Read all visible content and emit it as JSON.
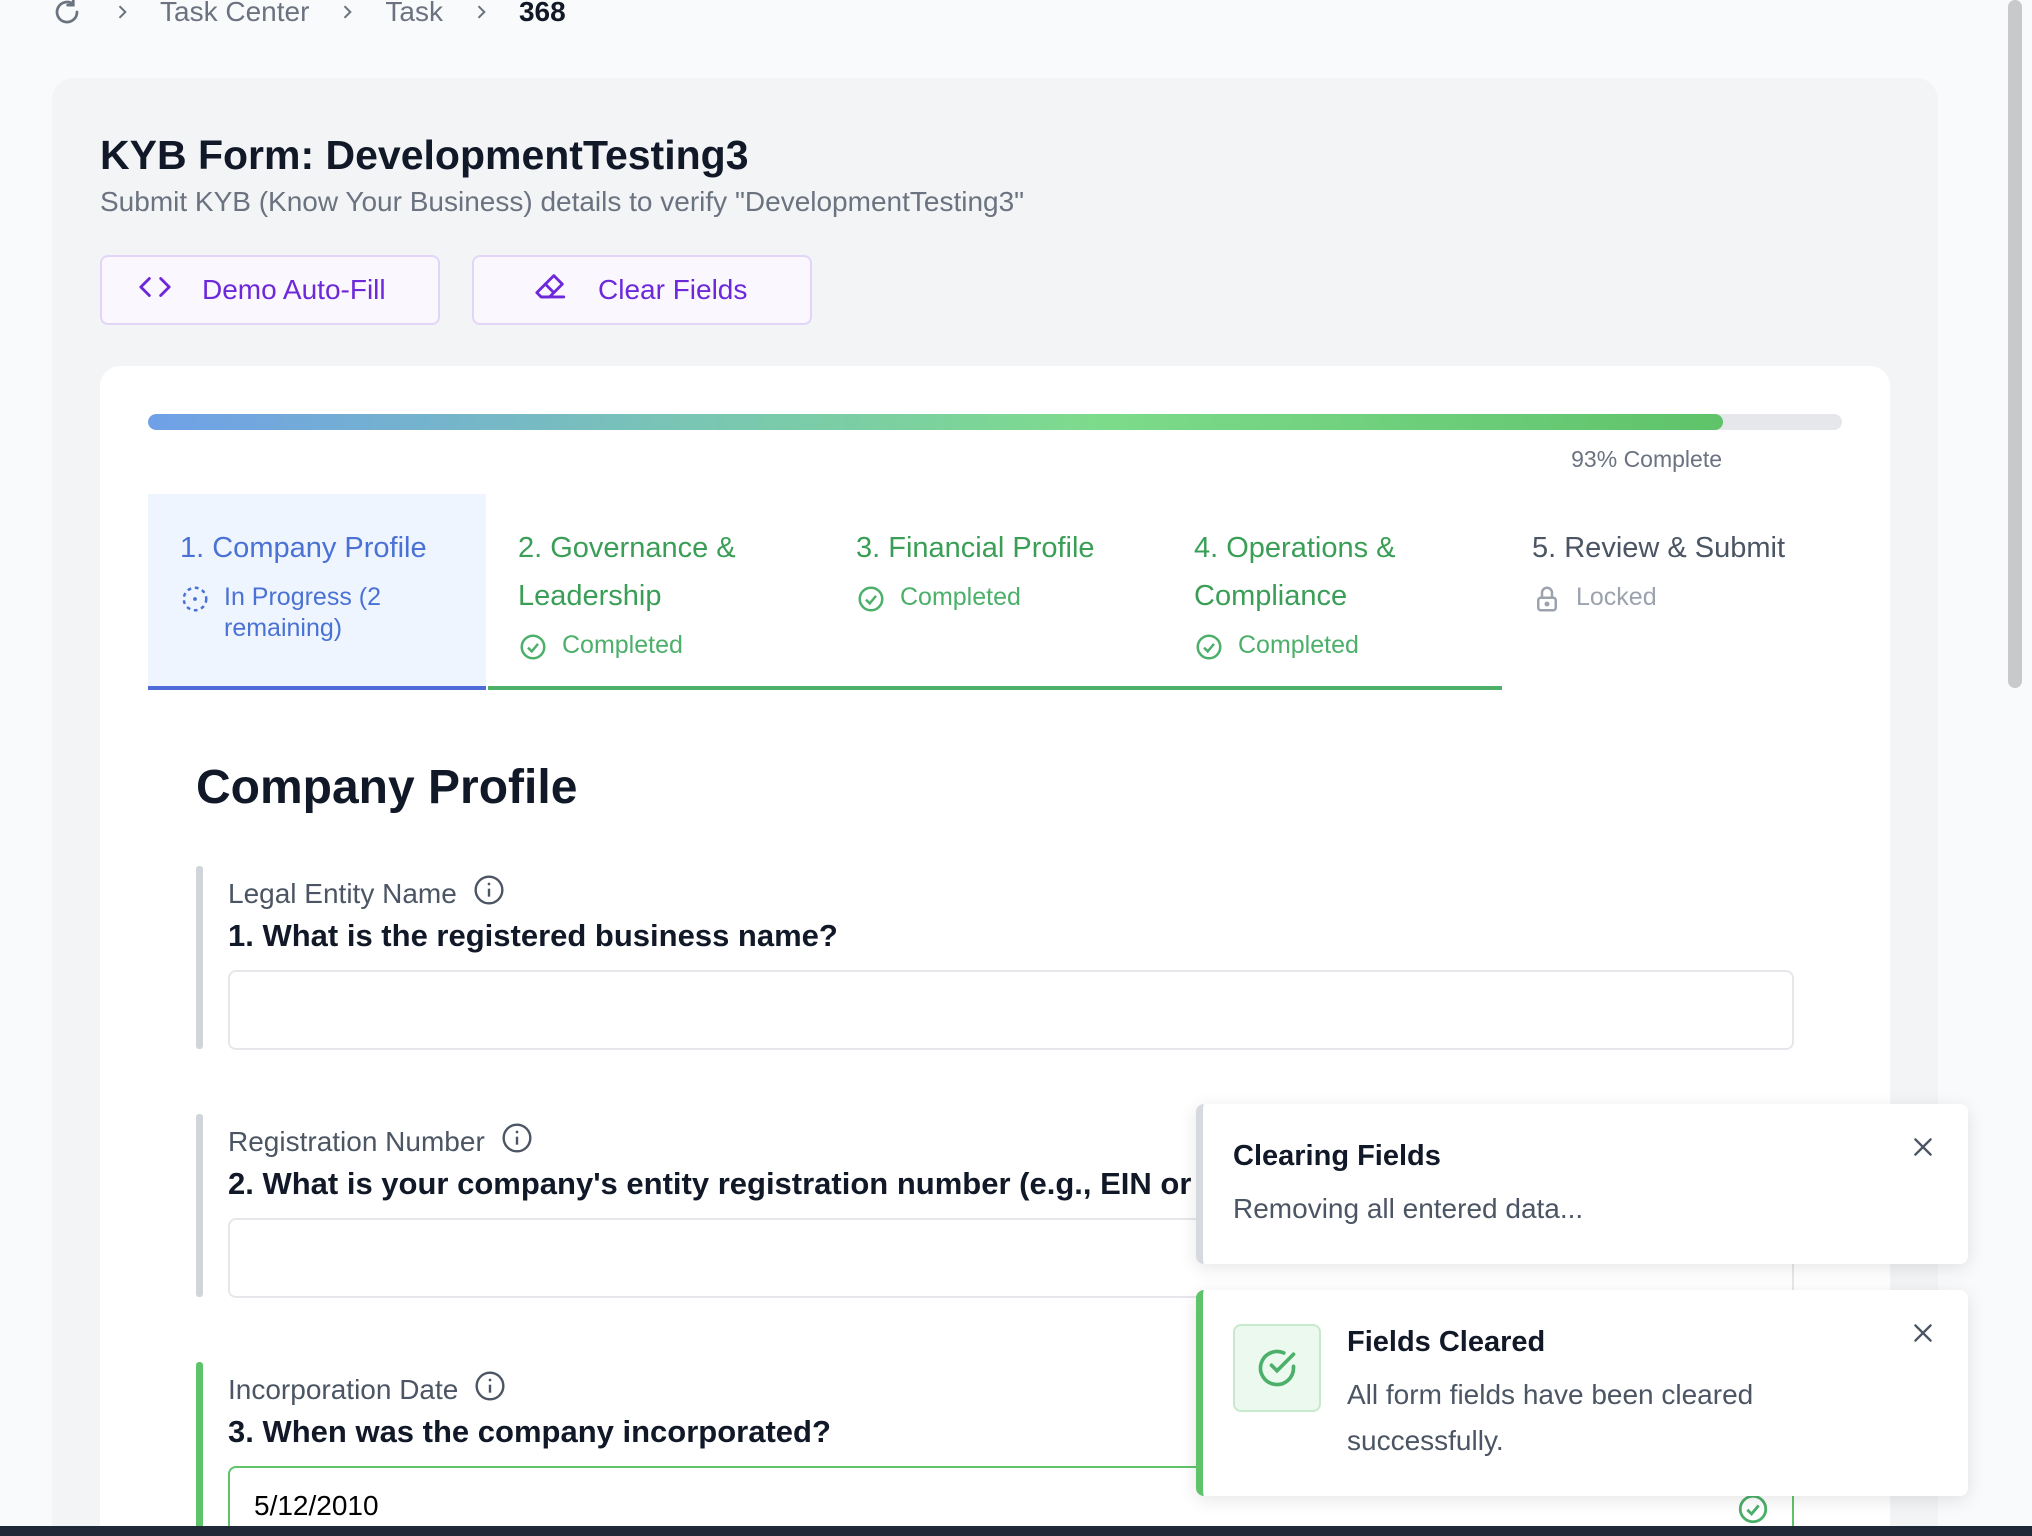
{
  "breadcrumb": {
    "items": [
      "Task Center",
      "Task",
      "368"
    ]
  },
  "form": {
    "title": "KYB Form: DevelopmentTesting3",
    "subtitle": "Submit KYB (Know Your Business) details to verify \"DevelopmentTesting3\"",
    "demo_button": "Demo Auto-Fill",
    "clear_button": "Clear Fields"
  },
  "progress": {
    "percent": 93,
    "label": "93% Complete"
  },
  "steps": [
    {
      "label": "1. Company Profile",
      "status": "In Progress (2 remaining)",
      "state": "active"
    },
    {
      "label": "2. Governance & Leadership",
      "status": "Completed",
      "state": "completed"
    },
    {
      "label": "3. Financial Profile",
      "status": "Completed",
      "state": "completed"
    },
    {
      "label": "4. Operations & Compliance",
      "status": "Completed",
      "state": "completed"
    },
    {
      "label": "5. Review & Submit",
      "status": "Locked",
      "state": "locked"
    }
  ],
  "section": {
    "title": "Company Profile",
    "questions": [
      {
        "field": "Legal Entity Name",
        "question": "1. What is the registered business name?",
        "value": ""
      },
      {
        "field": "Registration Number",
        "question": "2. What is your company's entity registration number (e.g., EIN or",
        "value": ""
      },
      {
        "field": "Incorporation Date",
        "question": "3. When was the company incorporated?",
        "value": "5/12/2010"
      }
    ]
  },
  "toasts": [
    {
      "title": "Clearing Fields",
      "body": "Removing all entered data..."
    },
    {
      "title": "Fields Cleared",
      "body": "All form fields have been cleared successfully."
    }
  ],
  "colors": {
    "accent_purple": "#6d28d9",
    "active_blue": "#4a72d4",
    "success_green": "#4caf6a",
    "locked_gray": "#9ca3af"
  }
}
